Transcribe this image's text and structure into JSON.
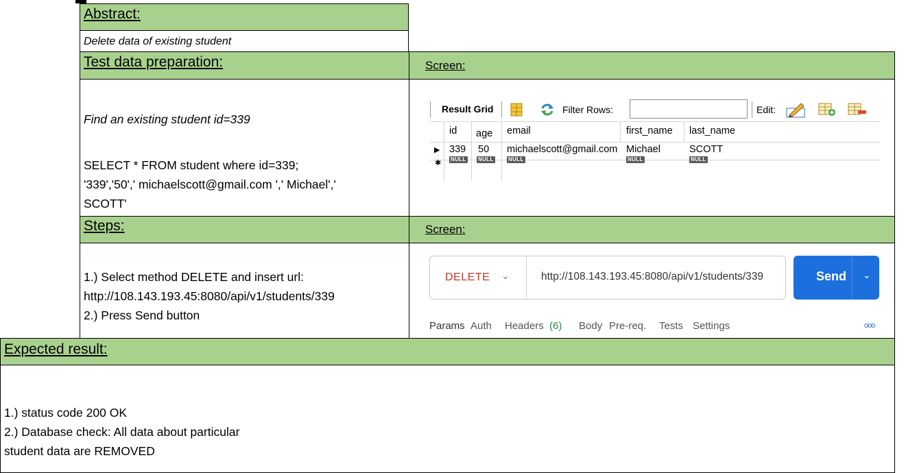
{
  "abstract": {
    "header": "Abstract:",
    "text": "Delete data of existing student"
  },
  "test_data": {
    "header": "Test data preparation:",
    "screen_header": "Screen:",
    "line1": "Find an existing student id=339",
    "line2": "SELECT * FROM student where id=339;",
    "line3": "'339','50',' michaelscott@gmail.com ',' Michael','",
    "line4": "SCOTT'"
  },
  "result_grid": {
    "label": "Result Grid",
    "filter_label": "Filter Rows:",
    "edit_label": "Edit:",
    "columns": [
      "id",
      "age",
      "email",
      "first_name",
      "last_name"
    ],
    "row": [
      "339",
      "50",
      "michaelscott@gmail.com",
      "Michael",
      "SCOTT"
    ],
    "null_text": "NULL"
  },
  "steps": {
    "header": "Steps:",
    "screen_header": "Screen:",
    "line1": "1.) Select method DELETE and insert url:",
    "line2": "http://108.143.193.45:8080/api/v1/students/339",
    "line3": "2.) Press Send button"
  },
  "request": {
    "method": "DELETE",
    "url": "http://108.143.193.45:8080/api/v1/students/339",
    "send_label": "Send",
    "tabs": [
      "Params",
      "Auth",
      "Headers",
      "Body",
      "Pre-req.",
      "Tests",
      "Settings"
    ],
    "headers_count": "(6)",
    "more_label": "ooo",
    "method_color": "#c0392b",
    "send_color": "#1c6fdc",
    "active_tab_color": "#f26b3a"
  },
  "expected": {
    "header": "Expected result:",
    "line1": "1.) status code 200 OK",
    "line2": "2.) Database check: All data about particular",
    "line3": "student data are REMOVED"
  },
  "colors": {
    "header_bg": "#a9d18e",
    "border": "#000000"
  }
}
